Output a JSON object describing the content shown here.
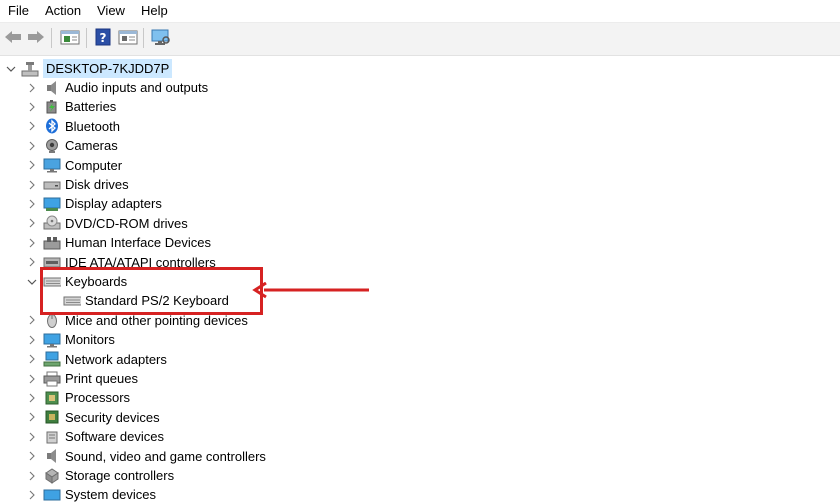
{
  "menu": [
    "File",
    "Action",
    "View",
    "Help"
  ],
  "toolbar": {
    "icons": [
      "back-arrow-icon",
      "forward-arrow-icon",
      "properties-icon",
      "help-icon",
      "view-icon",
      "scan-hardware-icon"
    ]
  },
  "tree": {
    "root": "DESKTOP-7KJDD7P",
    "categories": [
      {
        "label": "Audio inputs and outputs",
        "icon": "speaker-icon"
      },
      {
        "label": "Batteries",
        "icon": "battery-icon"
      },
      {
        "label": "Bluetooth",
        "icon": "bluetooth-icon"
      },
      {
        "label": "Cameras",
        "icon": "camera-icon"
      },
      {
        "label": "Computer",
        "icon": "computer-icon"
      },
      {
        "label": "Disk drives",
        "icon": "disk-drive-icon"
      },
      {
        "label": "Display adapters",
        "icon": "display-adapter-icon"
      },
      {
        "label": "DVD/CD-ROM drives",
        "icon": "dvd-drive-icon"
      },
      {
        "label": "Human Interface Devices",
        "icon": "hid-icon"
      },
      {
        "label": "IDE ATA/ATAPI controllers",
        "icon": "ide-controller-icon"
      },
      {
        "label": "Keyboards",
        "icon": "keyboard-icon",
        "expanded": true
      },
      {
        "label": "Mice and other pointing devices",
        "icon": "mouse-icon"
      },
      {
        "label": "Monitors",
        "icon": "monitor-icon"
      },
      {
        "label": "Network adapters",
        "icon": "network-adapter-icon"
      },
      {
        "label": "Print queues",
        "icon": "printer-icon"
      },
      {
        "label": "Processors",
        "icon": "processor-icon"
      },
      {
        "label": "Security devices",
        "icon": "security-device-icon"
      },
      {
        "label": "Software devices",
        "icon": "software-device-icon"
      },
      {
        "label": "Sound, video and game controllers",
        "icon": "sound-controller-icon"
      },
      {
        "label": "Storage controllers",
        "icon": "storage-controller-icon"
      },
      {
        "label": "System devices",
        "icon": "system-device-icon"
      }
    ],
    "keyboard_child": "Standard PS/2 Keyboard"
  },
  "colors": {
    "annotation": "#d62222",
    "selection": "#cce8ff"
  }
}
